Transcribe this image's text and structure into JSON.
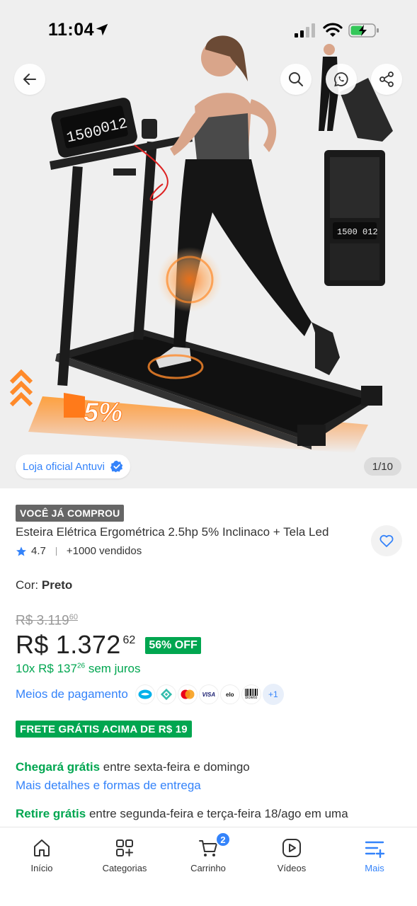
{
  "status_bar": {
    "time": "11:04"
  },
  "gallery": {
    "display_left": "1500",
    "display_right": "012",
    "thumb_display": "1500 012",
    "incline_label": "5%",
    "official_store": "Loja oficial Antuvi",
    "counter": "1/10"
  },
  "product": {
    "badge": "VOCÊ JÁ COMPROU",
    "title": "Esteira Elétrica Ergométrica 2.5hp 5% Inclinaco + Tela Led",
    "rating": "4.7",
    "sold": "+1000 vendidos",
    "color_label": "Cor:",
    "color_value": "Preto",
    "old_price_int": "R$ 3.119",
    "old_price_cents": "60",
    "price_int": "R$ 1.372",
    "price_cents": "62",
    "discount": "56% OFF",
    "installments_prefix": "10x R$ 137",
    "installments_cents": "26",
    "installments_suffix": "sem juros",
    "payment_link": "Meios de pagamento",
    "payment_methods": [
      "mercado-pago",
      "pix",
      "mastercard",
      "VISA",
      "elo",
      "Boleto"
    ],
    "payment_more": "+1",
    "free_shipping": "FRETE GRÁTIS ACIMA DE R$ 19",
    "arrive_bold": "Chegará grátis",
    "arrive_text": "entre sexta-feira e domingo",
    "details_link": "Mais detalhes e formas de entrega",
    "pickup_bold": "Retire grátis",
    "pickup_text": "entre segunda-feira e terça-feira 18/ago em uma"
  },
  "tabbar": {
    "items": [
      {
        "label": "Início",
        "icon": "home-icon"
      },
      {
        "label": "Categorias",
        "icon": "categories-icon"
      },
      {
        "label": "Carrinho",
        "icon": "cart-icon",
        "badge": "2"
      },
      {
        "label": "Vídeos",
        "icon": "video-icon"
      },
      {
        "label": "Mais",
        "icon": "menu-plus-icon",
        "active": true
      }
    ]
  },
  "colors": {
    "accent": "#3483fa",
    "green": "#00a650",
    "orange": "#ff7a1a"
  }
}
